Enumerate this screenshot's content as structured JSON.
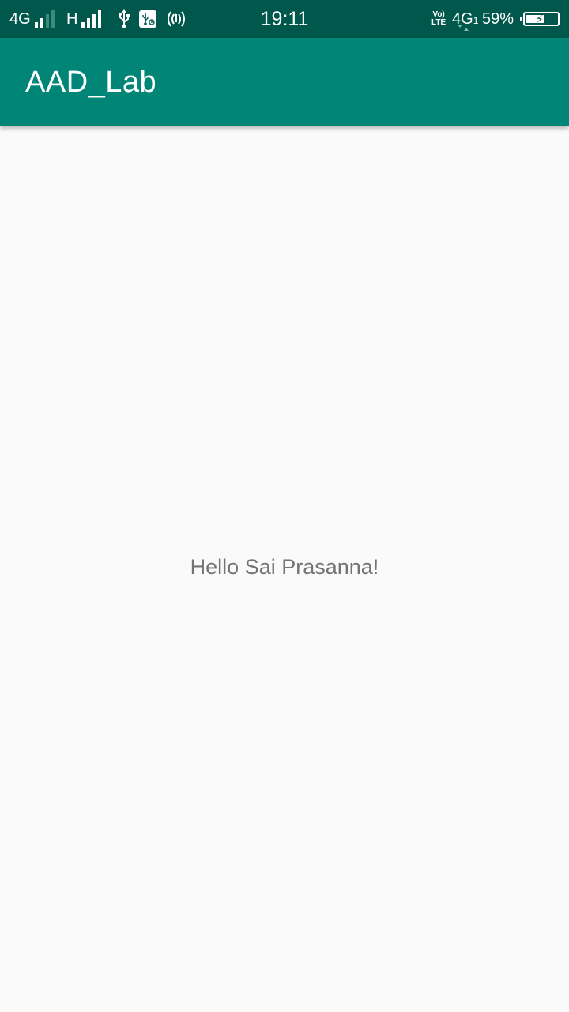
{
  "status_bar": {
    "sim1_network": "4G",
    "sim1_signal_level": 2,
    "sim2_network": "H",
    "sim2_signal_level": 4,
    "volte_line1": "Vo)",
    "volte_line2": "LTE",
    "data_network": "4G",
    "data_network_sim": "1",
    "time": "19:11",
    "battery_percent": "59%",
    "battery_level": 0.59,
    "icons": [
      "usb-icon",
      "usb-debug-icon",
      "hotspot-icon",
      "charging-icon"
    ]
  },
  "app_bar": {
    "title": "AAD_Lab",
    "color": "#008577"
  },
  "main": {
    "greeting": "Hello Sai Prasanna!"
  },
  "colors": {
    "status_bar": "#00574b",
    "app_bar": "#008577",
    "background": "#fafafa",
    "text": "#737373"
  }
}
